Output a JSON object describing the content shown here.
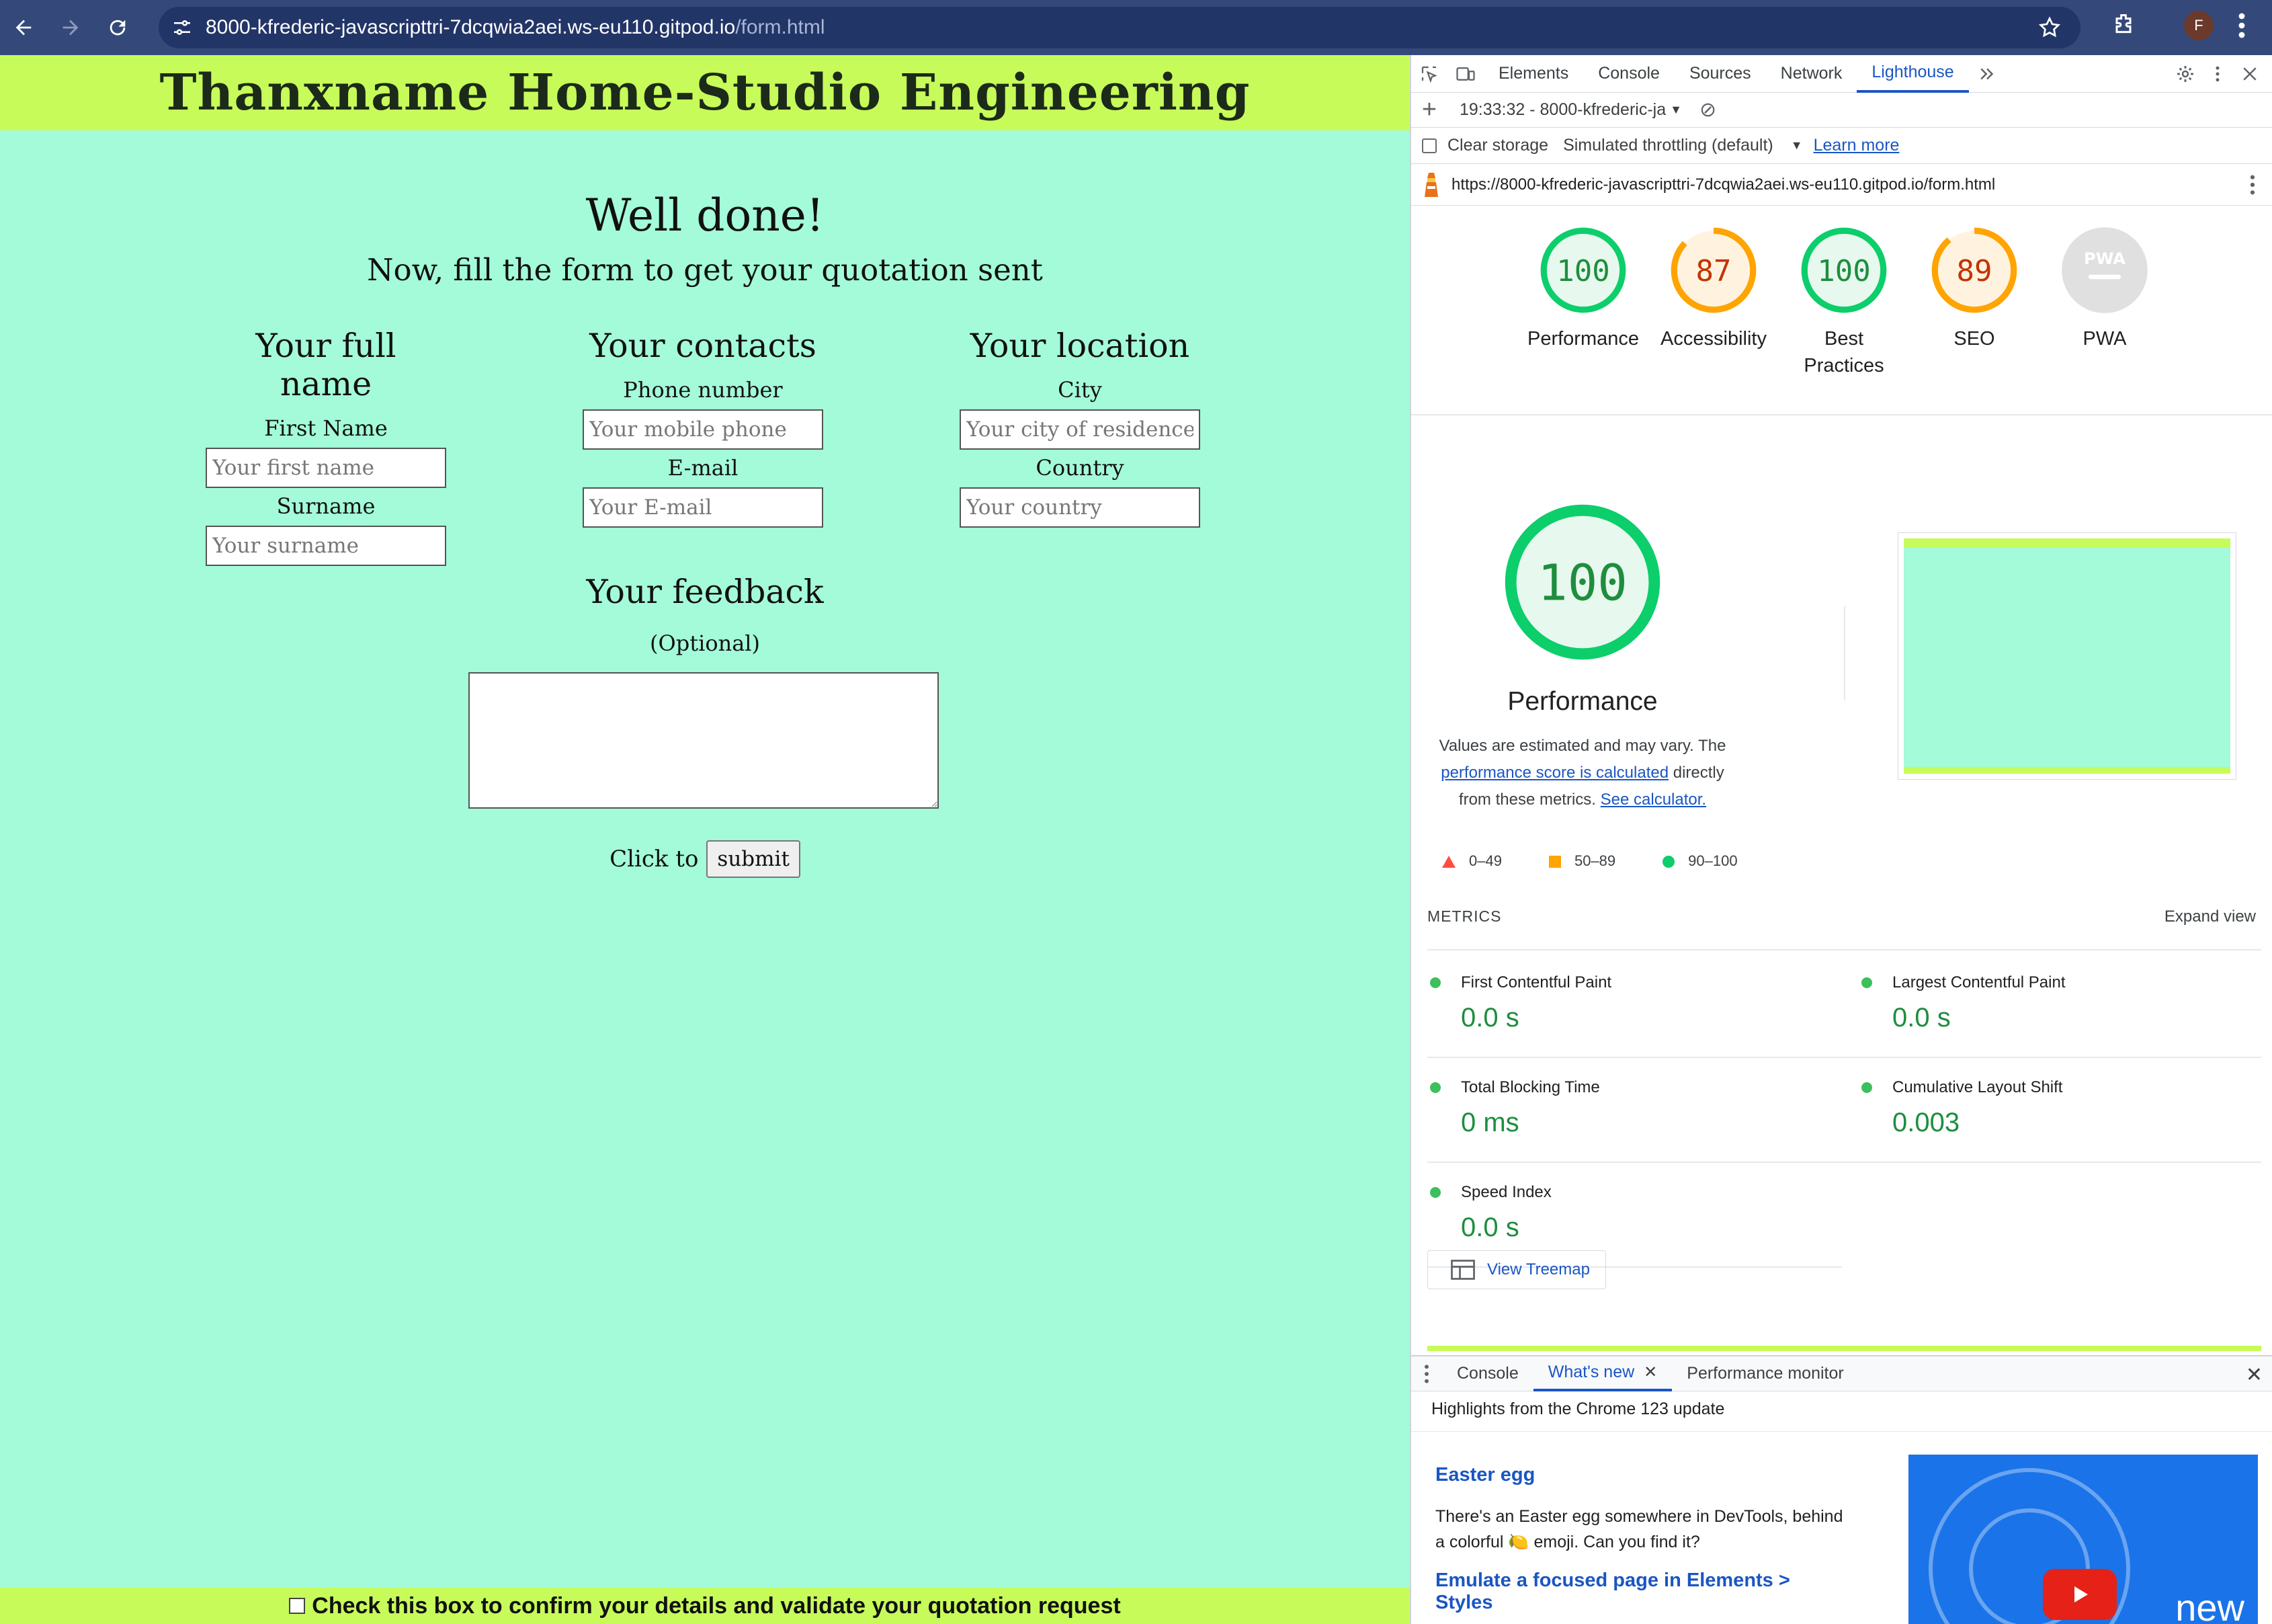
{
  "browser": {
    "url_host": "8000-kfrederic-javascripttri-7dcqwia2aei.ws-eu110.gitpod.io",
    "url_path": "/form.html",
    "profile_initial": "F"
  },
  "page": {
    "banner_title": "Thanxname Home-Studio Engineering",
    "heading": "Well done!",
    "subheading": "Now, fill the form to get your quotation sent",
    "columns": [
      {
        "title": "Your full name",
        "label1": "First Name",
        "placeholder1": "Your first name",
        "label2": "Surname",
        "placeholder2": "Your surname"
      },
      {
        "title": "Your contacts",
        "label1": "Phone number",
        "placeholder1": "Your mobile phone",
        "label2": "E-mail",
        "placeholder2": "Your E-mail"
      },
      {
        "title": "Your location",
        "label1": "City",
        "placeholder1": "Your city of residence",
        "label2": "Country",
        "placeholder2": "Your country"
      }
    ],
    "feedback_title": "Your feedback",
    "feedback_optional": "(Optional)",
    "click_to": "Click to",
    "submit_label": "submit",
    "footer_confirm": "Check this box to confirm your details and validate your quotation request"
  },
  "devtools": {
    "tabs": [
      "Elements",
      "Console",
      "Sources",
      "Network",
      "Lighthouse"
    ],
    "active_tab": "Lighthouse",
    "report_selector": "19:33:32 - 8000-kfrederic-ja",
    "clear_storage": "Clear storage",
    "throttling": "Simulated throttling (default)",
    "learn_more": "Learn more",
    "report_url": "https://8000-kfrederic-javascripttri-7dcqwia2aei.ws-eu110.gitpod.io/form.html",
    "scores": [
      {
        "label": "Performance",
        "value": "100",
        "level": "pass"
      },
      {
        "label": "Accessibility",
        "value": "87",
        "level": "average"
      },
      {
        "label": "Best Practices",
        "value": "100",
        "level": "pass"
      },
      {
        "label": "SEO",
        "value": "89",
        "level": "average"
      },
      {
        "label": "PWA",
        "value": "PWA",
        "level": "na"
      }
    ],
    "score_fractions": [
      1.0,
      0.87,
      1.0,
      0.89,
      0
    ],
    "perf_big_value": "100",
    "perf_title": "Performance",
    "perf_desc_1": "Values are estimated and may vary. The ",
    "perf_link_1": "performance score is calculated",
    "perf_desc_2": " directly from these metrics. ",
    "perf_link_2": "See calculator.",
    "legend": [
      "0–49",
      "50–89",
      "90–100"
    ],
    "metrics_heading": "METRICS",
    "expand_view": "Expand view",
    "metrics": [
      {
        "name": "First Contentful Paint",
        "value": "0.0 s"
      },
      {
        "name": "Largest Contentful Paint",
        "value": "0.0 s"
      },
      {
        "name": "Total Blocking Time",
        "value": "0 ms"
      },
      {
        "name": "Cumulative Layout Shift",
        "value": "0.003"
      },
      {
        "name": "Speed Index",
        "value": "0.0 s"
      }
    ],
    "view_treemap": "View Treemap",
    "drawer_tabs": [
      "Console",
      "What's new",
      "Performance monitor"
    ],
    "drawer_active": "What's new",
    "highlights": "Highlights from the Chrome 123 update",
    "news": [
      {
        "title": "Easter egg",
        "body": "There's an Easter egg somewhere in DevTools, behind a colorful 🍋 emoji. Can you find it?"
      },
      {
        "title": "Emulate a focused page in Elements > Styles",
        "body": ""
      }
    ],
    "video_text": "new"
  },
  "colors": {
    "page_bg": "#a3fbd9",
    "banner_bg": "#c7fb5a",
    "pass": "#0cce6b",
    "average": "#ffa400",
    "fail": "#ff4e42",
    "accent": "#1a56c4"
  }
}
